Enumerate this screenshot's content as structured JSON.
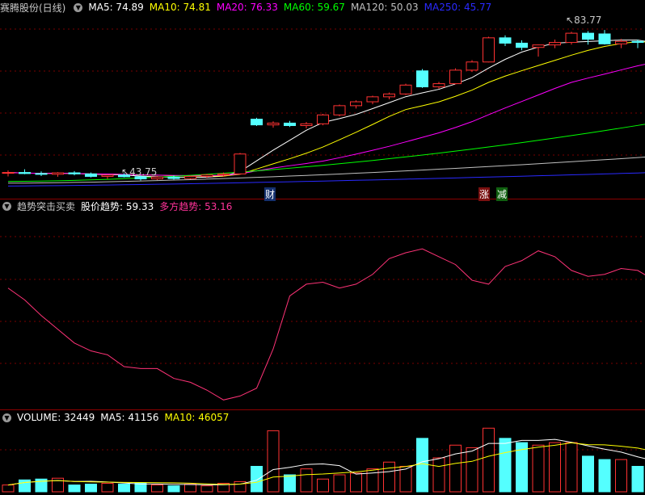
{
  "price_panel": {
    "stock_name": "赛腾股份(日线)",
    "ma_items": [
      {
        "label": "MA5: 74.89",
        "color": "#ffffff"
      },
      {
        "label": "MA10: 74.81",
        "color": "#ffff00"
      },
      {
        "label": "MA20: 76.33",
        "color": "#ff00ff"
      },
      {
        "label": "MA60: 59.67",
        "color": "#00ff00"
      },
      {
        "label": "MA120: 50.03",
        "color": "#c0c0c0"
      },
      {
        "label": "MA250: 45.77",
        "color": "#2a2aff"
      }
    ],
    "high_label": "83.77",
    "low_label": "43.75",
    "markers": [
      {
        "text": "财",
        "bg": "#1a3a8a",
        "color": "#ffffff"
      },
      {
        "text": "涨",
        "bg": "#8a1a1a",
        "color": "#ffffff"
      },
      {
        "text": "减",
        "bg": "#1a6a1a",
        "color": "#ffffff"
      }
    ]
  },
  "indicator_panel": {
    "name": "趋势突击买卖",
    "items": [
      {
        "label": "股价趋势: 59.33",
        "color": "#ffffff"
      },
      {
        "label": "多方趋势: 53.16",
        "color": "#ff3399"
      }
    ]
  },
  "volume_panel": {
    "items": [
      {
        "label": "VOLUME: 32449",
        "color": "#ffffff"
      },
      {
        "label": "MA5: 41156",
        "color": "#ffffff"
      },
      {
        "label": "MA10: 46057",
        "color": "#ffff00"
      }
    ]
  },
  "chart_data": {
    "type": "candlestick",
    "candles": [
      [
        45.8,
        46.6,
        44.9,
        46.0
      ],
      [
        46.0,
        46.9,
        45.5,
        45.7
      ],
      [
        45.7,
        46.3,
        45.0,
        45.5
      ],
      [
        45.5,
        46.1,
        44.8,
        45.9
      ],
      [
        45.9,
        46.4,
        45.2,
        45.6
      ],
      [
        45.6,
        46.0,
        44.6,
        44.9
      ],
      [
        44.9,
        45.4,
        44.2,
        45.3
      ],
      [
        45.3,
        45.8,
        44.6,
        44.8
      ],
      [
        44.8,
        45.2,
        43.75,
        44.2
      ],
      [
        44.2,
        45.0,
        43.9,
        44.7
      ],
      [
        44.7,
        45.2,
        44.0,
        44.3
      ],
      [
        44.3,
        45.1,
        44.1,
        44.9
      ],
      [
        44.9,
        45.6,
        44.5,
        45.3
      ],
      [
        45.3,
        46.0,
        44.8,
        45.6
      ],
      [
        45.6,
        51.5,
        45.4,
        51.2
      ],
      [
        61.0,
        61.4,
        59.1,
        59.4
      ],
      [
        59.4,
        60.4,
        58.6,
        59.9
      ],
      [
        59.9,
        60.5,
        58.8,
        59.2
      ],
      [
        59.2,
        60.2,
        58.4,
        59.7
      ],
      [
        59.7,
        62.5,
        59.3,
        62.2
      ],
      [
        62.2,
        65.1,
        61.8,
        64.8
      ],
      [
        64.8,
        66.3,
        64.0,
        65.9
      ],
      [
        65.9,
        67.6,
        65.2,
        67.3
      ],
      [
        67.3,
        68.5,
        66.6,
        68.1
      ],
      [
        68.1,
        71.0,
        67.8,
        70.6
      ],
      [
        74.6,
        75.1,
        69.8,
        70.1
      ],
      [
        70.1,
        71.5,
        69.6,
        71.0
      ],
      [
        71.0,
        75.3,
        70.8,
        74.8
      ],
      [
        74.8,
        77.6,
        74.3,
        77.1
      ],
      [
        77.1,
        84.2,
        77.0,
        83.9
      ],
      [
        83.9,
        84.6,
        81.6,
        82.4
      ],
      [
        82.4,
        83.2,
        80.4,
        81.2
      ],
      [
        81.2,
        82.0,
        78.6,
        81.9
      ],
      [
        81.9,
        83.4,
        81.0,
        82.6
      ],
      [
        82.6,
        85.6,
        82.0,
        85.2
      ],
      [
        85.2,
        85.8,
        82.0,
        83.5
      ],
      [
        85.0,
        86.1,
        82.0,
        82.2
      ],
      [
        82.2,
        83.6,
        81.0,
        82.9
      ],
      [
        82.9,
        83.4,
        81.0,
        82.6
      ],
      [
        82.6,
        84.0,
        80.8,
        81.5
      ]
    ],
    "volume": [
      8,
      14,
      15,
      16,
      8,
      9,
      10,
      9,
      10,
      8,
      7,
      9,
      7,
      10,
      12,
      30,
      72,
      20,
      27,
      15,
      20,
      22,
      27,
      35,
      30,
      63,
      40,
      55,
      52,
      75,
      63,
      58,
      55,
      58,
      58,
      42,
      38,
      38,
      30,
      35
    ],
    "trend_stock": [
      61,
      59,
      57,
      53,
      50,
      48,
      45,
      44,
      42,
      41,
      39,
      39,
      38,
      37,
      36,
      32,
      25,
      47,
      63,
      70,
      71,
      69,
      70,
      74,
      78,
      79,
      78,
      75,
      72,
      65,
      64,
      72,
      74,
      78,
      77,
      73,
      70,
      71,
      73,
      72
    ],
    "trend_bull": [
      61,
      55,
      47,
      40,
      33,
      29,
      27,
      21,
      20,
      20,
      15,
      13,
      9,
      4,
      6,
      10,
      30,
      57,
      63,
      64,
      61,
      63,
      68,
      76,
      79,
      81,
      77,
      73,
      65,
      63,
      72,
      75,
      80,
      77,
      70,
      67,
      68,
      71,
      70,
      65
    ]
  }
}
